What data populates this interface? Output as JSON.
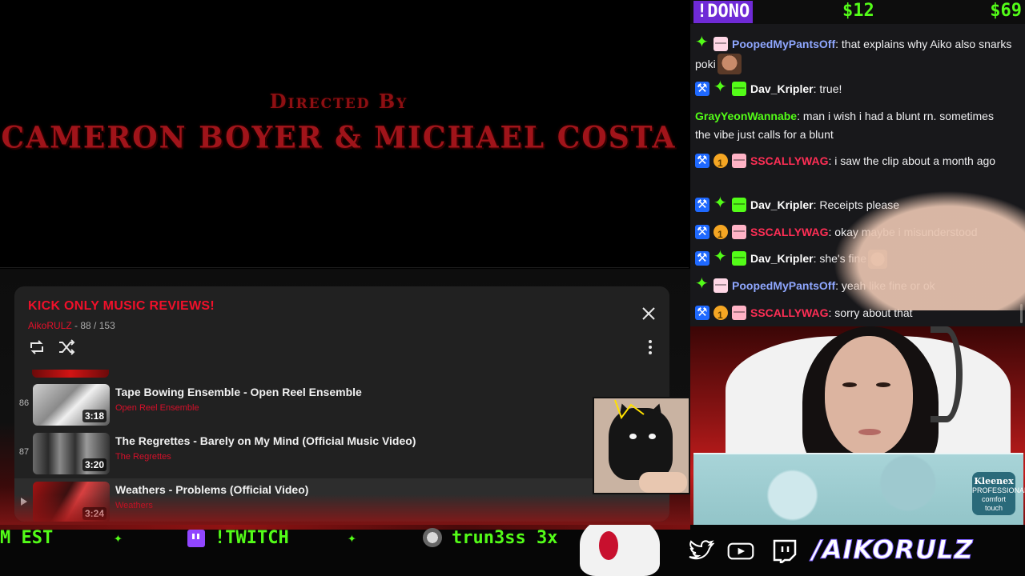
{
  "video": {
    "credit_sub": "Directed By",
    "credit_names": "CAMERON BOYER & MICHAEL COSTA"
  },
  "playlist": {
    "title": "KICK ONLY MUSIC REVIEWS!",
    "owner": "AikoRULZ",
    "position": "88 / 153",
    "items": [
      {
        "index": "86",
        "title": "Tape Bowing Ensemble - Open Reel Ensemble",
        "channel": "Open Reel Ensemble",
        "duration": "3:18"
      },
      {
        "index": "87",
        "title": "The Regrettes - Barely on My Mind (Official Music Video)",
        "channel": "The Regrettes",
        "duration": "3:20"
      },
      {
        "index": "",
        "title": "Weathers - Problems (Official Video)",
        "channel": "Weathers",
        "duration": "3:24"
      }
    ]
  },
  "dono": {
    "label": "!DONO",
    "amount_1": "$12",
    "amount_2": "$69"
  },
  "chat": {
    "messages": [
      {
        "user": "PoopedMyPantsOff",
        "color": "#8fa7ff",
        "text": ": that explains why Aiko also snarks poki"
      },
      {
        "user": "Dav_Kripler",
        "color": "#ffffff",
        "text": ": true!"
      },
      {
        "user": "GrayYeonWannabe",
        "color": "#53fc18",
        "text": ": man i wish i had a blunt rn. sometimes the vibe just calls for a blunt"
      },
      {
        "user": "SSCALLYWAG",
        "color": "#ff2e55",
        "text": ": i saw the clip about a month ago"
      },
      {
        "user": "Dav_Kripler",
        "color": "#ffffff",
        "text": ": Receipts please"
      },
      {
        "user": "SSCALLYWAG",
        "color": "#ff2e55",
        "text": ": okay maybe i misunderstood"
      },
      {
        "user": "Dav_Kripler",
        "color": "#ffffff",
        "text": ": she's fine"
      },
      {
        "user": "PoopedMyPantsOff",
        "color": "#8fa7ff",
        "text": ": yeah like fine or ok"
      },
      {
        "user": "SSCALLYWAG",
        "color": "#ff2e55",
        "text": ": sorry about that"
      }
    ]
  },
  "ticker": {
    "item_1": "M EST",
    "item_2": "!TWITCH",
    "item_3": "trun3ss 3x",
    "handle": "/AIKORULZ"
  },
  "webcam": {
    "tissue_brand": "Kleenex",
    "tissue_line_1": "PROFESSIONAL",
    "tissue_line_2": "comfort touch"
  },
  "colors": {
    "accent_red": "#f0102a",
    "kick_green": "#53fc18",
    "twitch_purple": "#9146ff",
    "chat_bg": "#18181b",
    "playlist_bg": "#212121"
  }
}
